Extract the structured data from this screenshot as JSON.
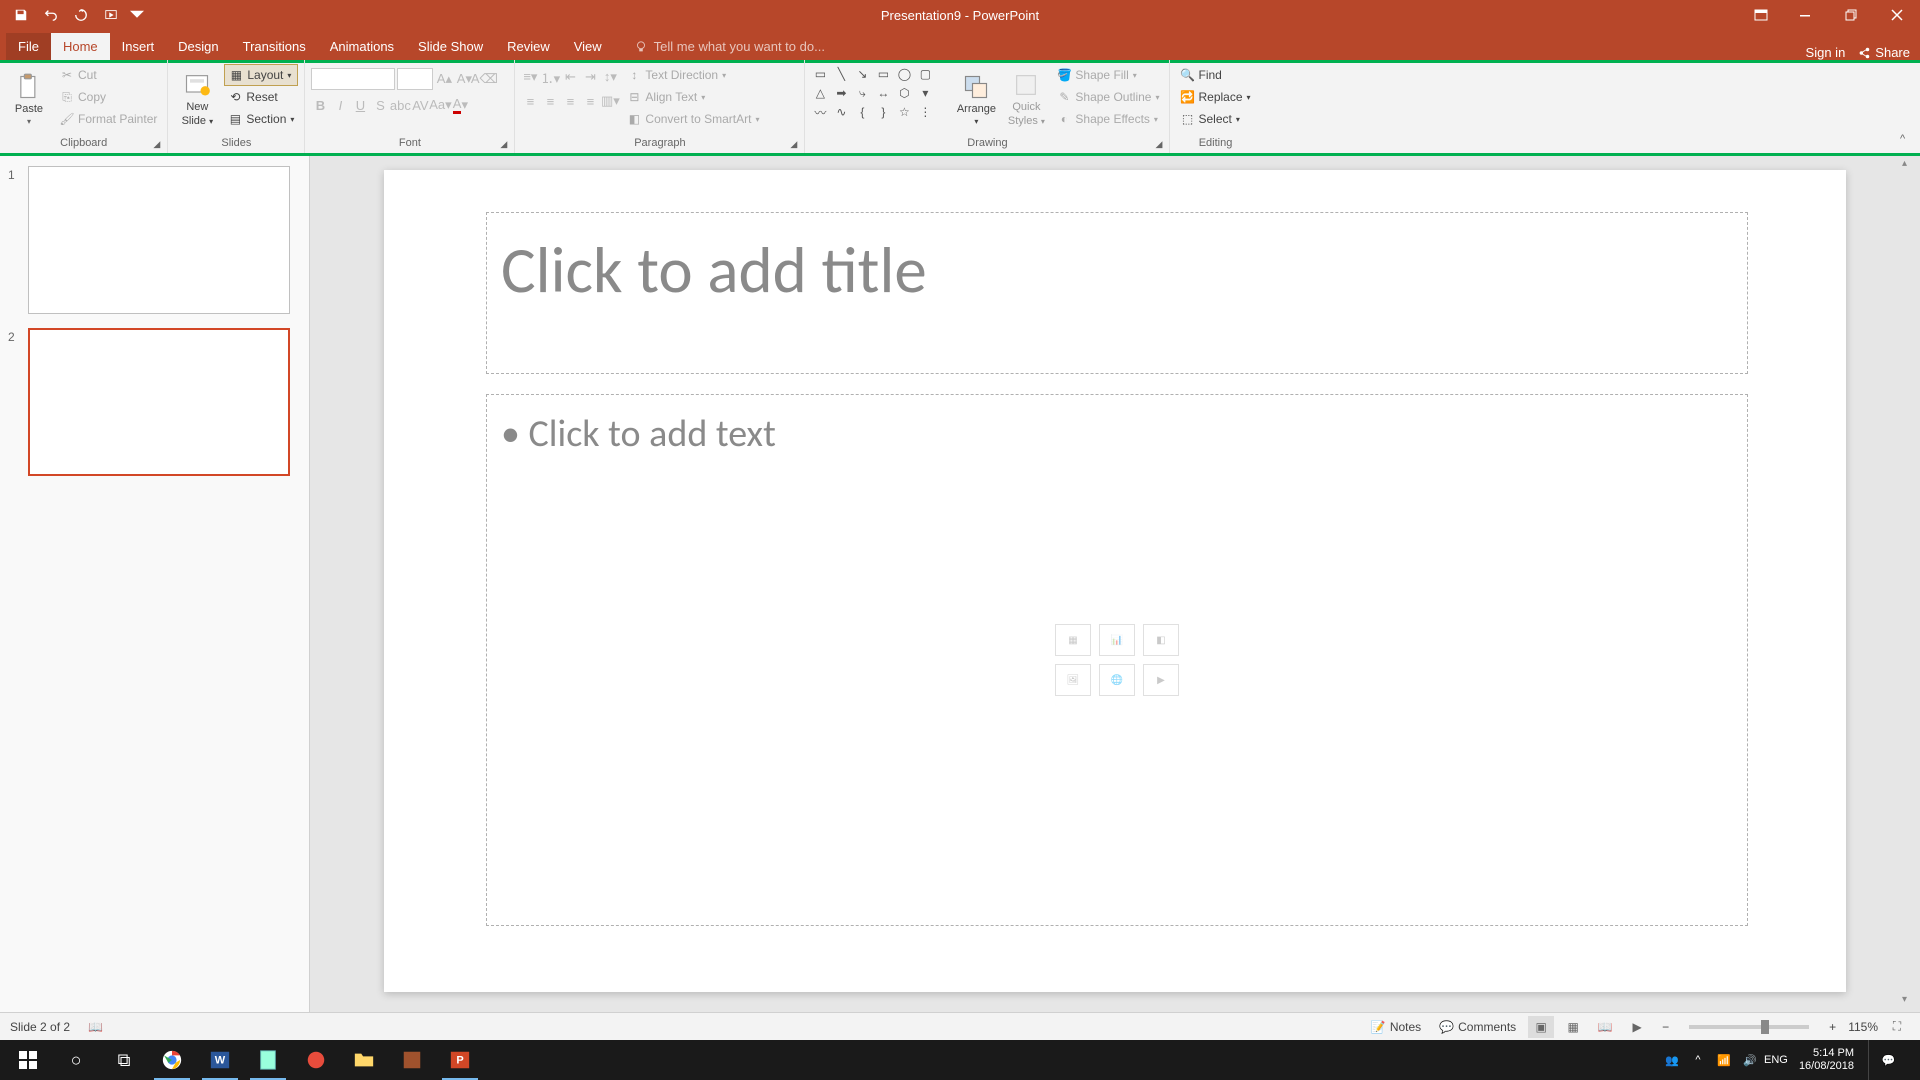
{
  "title_bar": {
    "title": "Presentation9 - PowerPoint"
  },
  "qat": {
    "save": "Save",
    "undo": "Undo",
    "redo": "Redo",
    "start_from_beginning": "Start From Beginning"
  },
  "tabs": {
    "file": "File",
    "home": "Home",
    "insert": "Insert",
    "design": "Design",
    "transitions": "Transitions",
    "animations": "Animations",
    "slideshow": "Slide Show",
    "review": "Review",
    "view": "View",
    "tell_me": "Tell me what you want to do...",
    "sign_in": "Sign in",
    "share": "Share"
  },
  "ribbon": {
    "clipboard": {
      "label": "Clipboard",
      "paste": "Paste",
      "cut": "Cut",
      "copy": "Copy",
      "format_painter": "Format Painter"
    },
    "slides": {
      "label": "Slides",
      "new_slide_line1": "New",
      "new_slide_line2": "Slide",
      "layout": "Layout",
      "reset": "Reset",
      "section": "Section"
    },
    "font": {
      "label": "Font"
    },
    "paragraph": {
      "label": "Paragraph",
      "text_direction": "Text Direction",
      "align_text": "Align Text",
      "convert_smartart": "Convert to SmartArt"
    },
    "drawing": {
      "label": "Drawing",
      "arrange": "Arrange",
      "quick_styles_line1": "Quick",
      "quick_styles_line2": "Styles",
      "shape_fill": "Shape Fill",
      "shape_outline": "Shape Outline",
      "shape_effects": "Shape Effects"
    },
    "editing": {
      "label": "Editing",
      "find": "Find",
      "replace": "Replace",
      "select": "Select"
    }
  },
  "thumbnails": [
    {
      "index": "1",
      "selected": false
    },
    {
      "index": "2",
      "selected": true
    }
  ],
  "slide": {
    "title_placeholder": "Click to add title",
    "content_placeholder": "Click to add text"
  },
  "status": {
    "slide_counter": "Slide 2 of 2",
    "notes": "Notes",
    "comments": "Comments",
    "zoom_minus": "−",
    "zoom_plus": "+",
    "zoom_pct": "115%"
  },
  "taskbar": {
    "time": "5:14 PM",
    "date": "16/08/2018"
  }
}
